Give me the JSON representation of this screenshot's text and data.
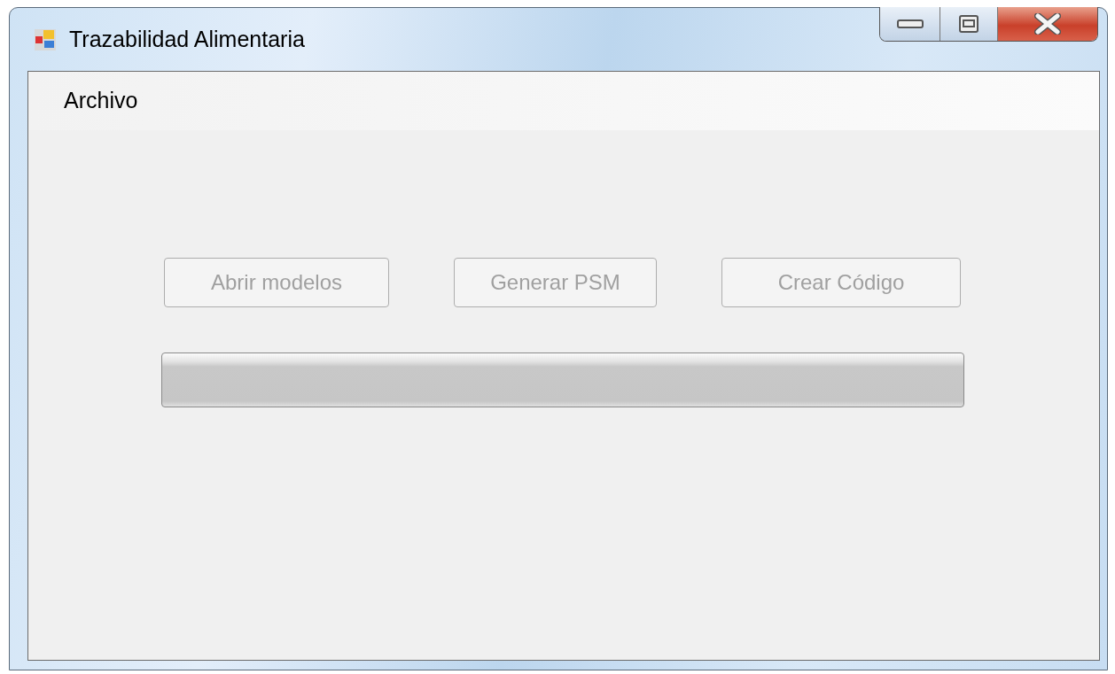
{
  "window": {
    "title": "Trazabilidad Alimentaria"
  },
  "menu": [
    {
      "label": "Archivo"
    }
  ],
  "buttons": [
    {
      "label": "Abrir modelos",
      "disabled": true
    },
    {
      "label": "Generar PSM",
      "disabled": true
    },
    {
      "label": "Crear Código",
      "disabled": true
    }
  ],
  "progress": {
    "level": 0
  }
}
